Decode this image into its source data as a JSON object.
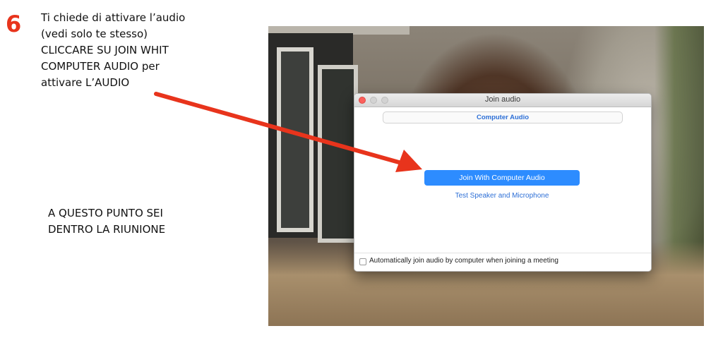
{
  "step": {
    "number": "6",
    "color": "#e8341c"
  },
  "instructions": {
    "lines": [
      "Ti chiede di attivare l’audio",
      "(vedi solo te stesso)",
      "CLICCARE SU JOIN WHIT",
      "COMPUTER AUDIO per",
      "attivare L’AUDIO"
    ],
    "note_lines": [
      "A QUESTO PUNTO SEI",
      "DENTRO LA RIUNIONE"
    ]
  },
  "dialog": {
    "title": "Join audio",
    "tab_label": "Computer Audio",
    "join_button_label": "Join With Computer Audio",
    "test_link_label": "Test Speaker and Microphone",
    "auto_join_label": "Automatically join audio by computer when joining a meeting",
    "auto_join_checked": false,
    "accent_color": "#2d8cff"
  },
  "icons": {
    "close": "close-dot-icon",
    "minimize": "minimize-dot-icon",
    "zoom": "zoom-dot-icon",
    "arrow": "red-arrow-icon"
  }
}
